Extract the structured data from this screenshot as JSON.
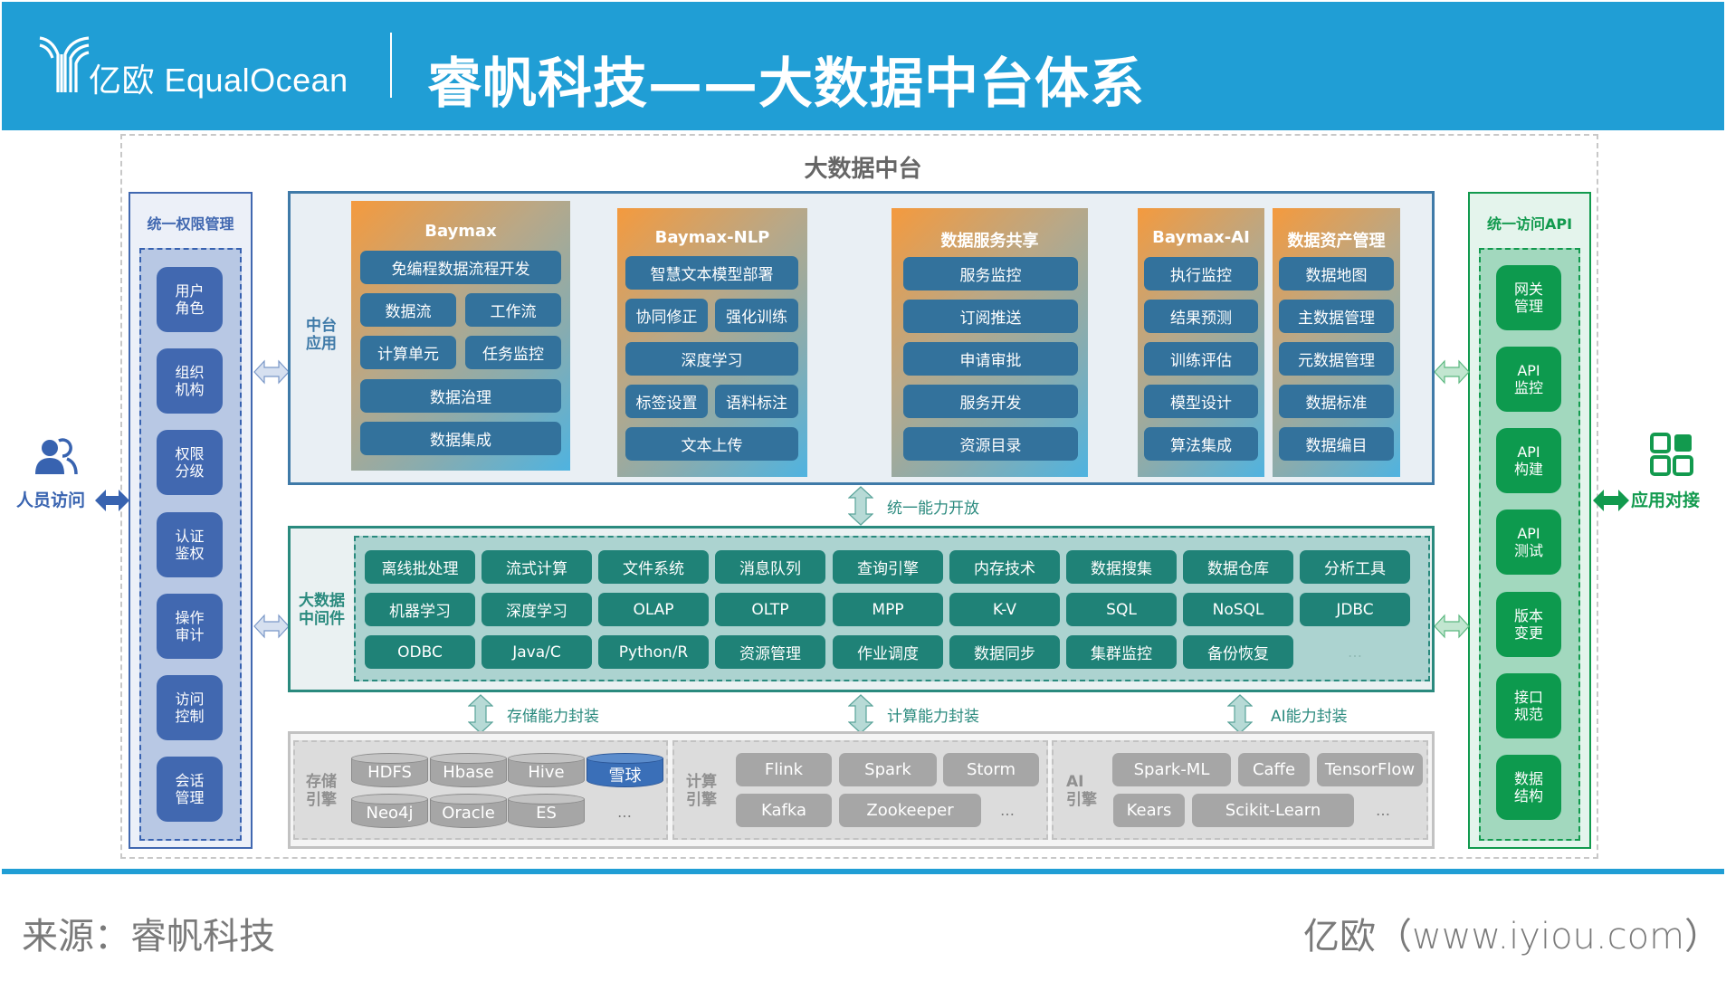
{
  "header": {
    "logo_text": "亿欧 EqualOcean",
    "title": "睿帆科技——大数据中台体系"
  },
  "platform_title": "大数据中台",
  "left_access": {
    "icon": "people-icon",
    "label": "人员访问"
  },
  "right_access": {
    "icon": "app-grid-icon",
    "label": "应用对接"
  },
  "permission_panel": {
    "title": "统一权限管理",
    "items": [
      "用户\n角色",
      "组织\n机构",
      "权限\n分级",
      "认证\n鉴权",
      "操作\n审计",
      "访问\n控制",
      "会话\n管理"
    ]
  },
  "api_panel": {
    "title": "统一访问API",
    "items": [
      "网关\n管理",
      "API\n监控",
      "API\n构建",
      "API\n测试",
      "版本\n变更",
      "接口\n规范",
      "数据\n结构"
    ]
  },
  "app_layer": {
    "label": "中台\n应用",
    "modules": [
      {
        "title": "Baymax",
        "items": [
          "免编程数据流程开发",
          "数据流",
          "工作流",
          "计算单元",
          "任务监控",
          "数据治理",
          "数据集成"
        ]
      },
      {
        "title": "Baymax-NLP",
        "items": [
          "智慧文本模型部署",
          "协同修正",
          "强化训练",
          "深度学习",
          "标签设置",
          "语料标注",
          "文本上传"
        ]
      },
      {
        "title": "数据服务共享",
        "items": [
          "服务监控",
          "订阅推送",
          "申请审批",
          "服务开发",
          "资源目录"
        ]
      },
      {
        "title": "Baymax-AI",
        "items": [
          "执行监控",
          "结果预测",
          "训练评估",
          "模型设计",
          "算法集成"
        ]
      },
      {
        "title": "数据资产管理",
        "items": [
          "数据地图",
          "主数据管理",
          "元数据管理",
          "数据标准",
          "数据编目"
        ]
      }
    ]
  },
  "connector_open": "统一能力开放",
  "middleware_layer": {
    "label": "大数据\n中间件",
    "rows": [
      [
        "离线批处理",
        "流式计算",
        "文件系统",
        "消息队列",
        "查询引擎",
        "内存技术",
        "数据搜集",
        "数据仓库",
        "分析工具"
      ],
      [
        "机器学习",
        "深度学习",
        "OLAP",
        "OLTP",
        "MPP",
        "K-V",
        "SQL",
        "NoSQL",
        "JDBC"
      ],
      [
        "ODBC",
        "Java/C",
        "Python/R",
        "资源管理",
        "作业调度",
        "数据同步",
        "集群监控",
        "备份恢复",
        "…"
      ]
    ]
  },
  "connectors": {
    "storage": "存储能力封装",
    "compute": "计算能力封装",
    "ai": "AI能力封装"
  },
  "engines": {
    "storage": {
      "label": "存储\n引擎",
      "row1": [
        "HDFS",
        "Hbase",
        "Hive",
        "雪球"
      ],
      "row2": [
        "Neo4j",
        "Oracle",
        "ES"
      ],
      "more": "…",
      "highlight_color": "#3a6fb8"
    },
    "compute": {
      "label": "计算\n引擎",
      "row1": [
        "Flink",
        "Spark",
        "Storm"
      ],
      "row2": [
        "Kafka",
        "Zookeeper"
      ],
      "more": "…"
    },
    "ai": {
      "label": "AI\n引擎",
      "row1": [
        "Spark-ML",
        "Caffe",
        "TensorFlow"
      ],
      "row2": [
        "Kears",
        "Scikit-Learn"
      ],
      "more": "…"
    }
  },
  "footer": {
    "source": "来源：睿帆科技",
    "credit": "亿欧（www.iyiou.com）"
  },
  "colors": {
    "brand_blue": "#209ed5",
    "permission_blue": "#4168b0",
    "api_green": "#0d9a4e",
    "app_button": "#33729c",
    "middleware_teal": "#1f8277",
    "engine_gray": "#a6a6a6"
  }
}
